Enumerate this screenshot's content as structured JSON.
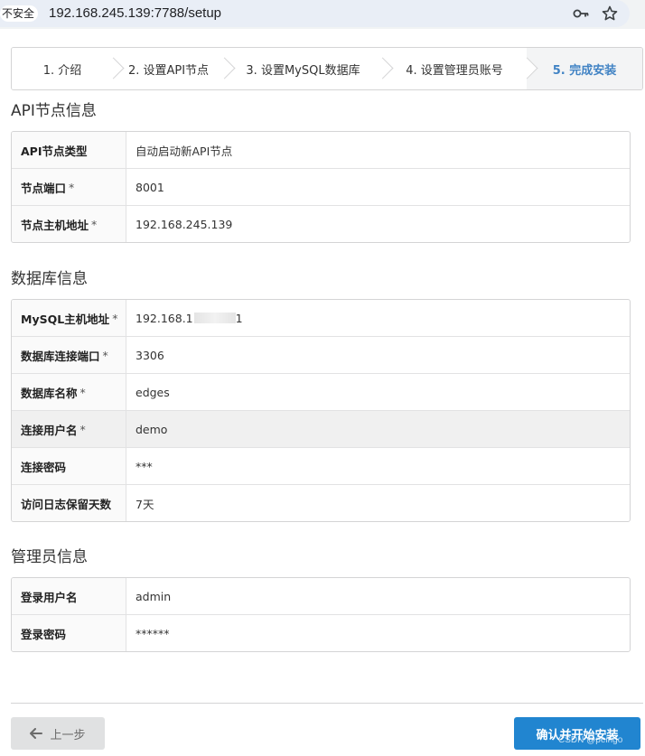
{
  "browser": {
    "insecure_label": "不安全",
    "url": "192.168.245.139:7788/setup",
    "icons": [
      "key-icon",
      "star-icon"
    ]
  },
  "steps": [
    {
      "label": "1. 介绍",
      "active": false
    },
    {
      "label": "2. 设置API节点",
      "active": false
    },
    {
      "label": "3. 设置MySQL数据库",
      "active": false
    },
    {
      "label": "4. 设置管理员账号",
      "active": false
    },
    {
      "label": "5. 完成安装",
      "active": true
    }
  ],
  "api_section": {
    "title": "API节点信息",
    "rows": [
      {
        "label": "API节点类型",
        "required": false,
        "value": "自动启动新API节点"
      },
      {
        "label": "节点端口",
        "required": true,
        "value": "8001"
      },
      {
        "label": "节点主机地址",
        "required": true,
        "value": "192.168.245.139"
      }
    ]
  },
  "db_section": {
    "title": "数据库信息",
    "rows": [
      {
        "label": "MySQL主机地址",
        "required": true,
        "value": "192.168.1",
        "value_suffix": "1"
      },
      {
        "label": "数据库连接端口",
        "required": true,
        "value": "3306"
      },
      {
        "label": "数据库名称",
        "required": true,
        "value": "edges"
      },
      {
        "label": "连接用户名",
        "required": true,
        "value": "demo"
      },
      {
        "label": "连接密码",
        "required": false,
        "value": "***"
      },
      {
        "label": "访问日志保留天数",
        "required": false,
        "value": "7天"
      }
    ]
  },
  "admin_section": {
    "title": "管理员信息",
    "rows": [
      {
        "label": "登录用户名",
        "required": false,
        "value": "admin"
      },
      {
        "label": "登录密码",
        "required": false,
        "value": "******"
      }
    ]
  },
  "required_mark": "*",
  "footer": {
    "prev_label": "上一步",
    "confirm_label": "确认并开始安装",
    "watermark": "CSDN @peirigo"
  },
  "colors": {
    "accent": "#2185d0",
    "active_step": "#4183c4",
    "border": "#d4d4d5"
  }
}
